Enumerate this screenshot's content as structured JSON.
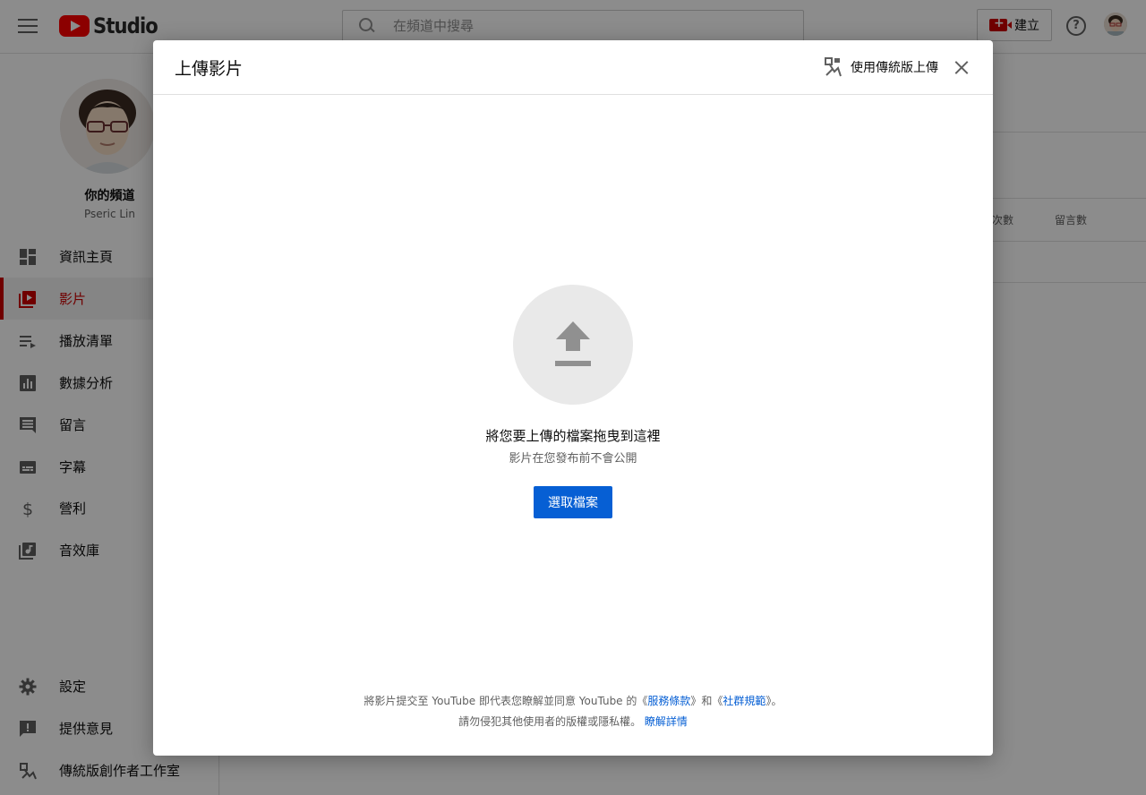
{
  "topbar": {
    "logo_text": "Studio",
    "search_placeholder": "在頻道中搜尋",
    "create_label": "建立",
    "help_glyph": "?"
  },
  "sidebar": {
    "channel_name": "你的頻道",
    "channel_owner": "Pseric Lin",
    "items": [
      {
        "label": "資訊主頁",
        "icon": "dashboard-icon"
      },
      {
        "label": "影片",
        "icon": "videos-icon",
        "active": true
      },
      {
        "label": "播放清單",
        "icon": "playlist-icon"
      },
      {
        "label": "數據分析",
        "icon": "analytics-icon"
      },
      {
        "label": "留言",
        "icon": "comments-icon"
      },
      {
        "label": "字幕",
        "icon": "subtitles-icon"
      },
      {
        "label": "營利",
        "icon": "dollar-icon"
      },
      {
        "label": "音效庫",
        "icon": "audio-library-icon"
      }
    ],
    "bottom_items": [
      {
        "label": "設定",
        "icon": "gear-icon"
      },
      {
        "label": "提供意見",
        "icon": "feedback-icon"
      },
      {
        "label": "傳統版創作者工作室",
        "icon": "classic-studio-icon"
      }
    ]
  },
  "background": {
    "col_views": "次數",
    "col_comments": "留言數"
  },
  "dialog": {
    "title": "上傳影片",
    "legacy_label": "使用傳統版上傳",
    "drop_title": "將您要上傳的檔案拖曳到這裡",
    "drop_subtitle": "影片在您發布前不會公開",
    "select_button": "選取檔案",
    "footer": {
      "line1_prefix": "將影片提交至 YouTube 即代表您瞭解並同意 YouTube 的《",
      "terms_link": "服務條款",
      "line1_mid": "》和《",
      "guidelines_link": "社群規範",
      "line1_suffix": "》。",
      "line2_prefix": "請勿侵犯其他使用者的版權或隱私權。 ",
      "learn_more_link": "瞭解詳情"
    }
  },
  "colors": {
    "accent_blue": "#065fd4",
    "brand_red": "#cc0000",
    "logo_red": "#ff0000"
  }
}
